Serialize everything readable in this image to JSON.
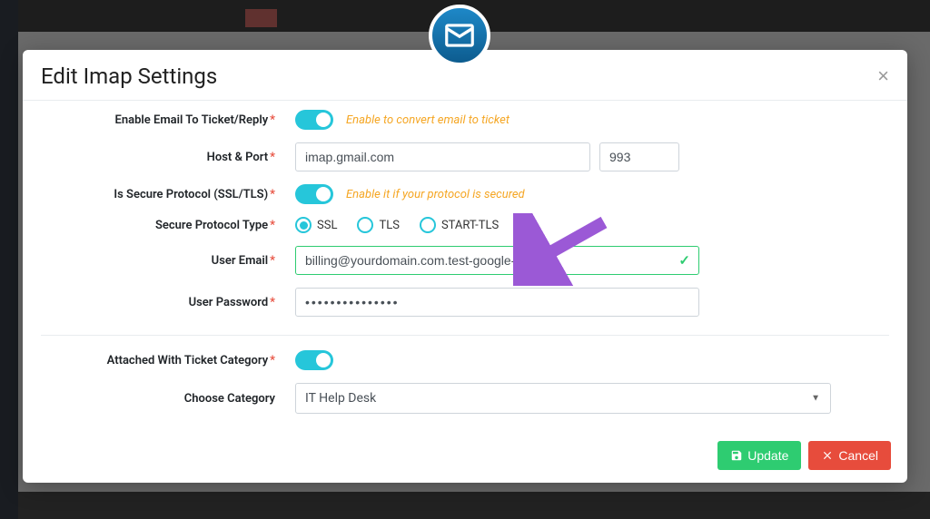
{
  "modal": {
    "title": "Edit Imap Settings",
    "fields": {
      "enable_email": {
        "label": "Enable Email To Ticket/Reply",
        "hint": "Enable to convert email to ticket",
        "value": true
      },
      "host": {
        "label": "Host & Port",
        "host_value": "imap.gmail.com",
        "port_value": "993"
      },
      "secure_protocol": {
        "label": "Is Secure Protocol (SSL/TLS)",
        "hint": "Enable it if your protocol is secured",
        "value": true
      },
      "protocol_type": {
        "label": "Secure Protocol Type",
        "options": [
          "SSL",
          "TLS",
          "START-TLS"
        ],
        "selected": "SSL"
      },
      "user_email": {
        "label": "User Email",
        "value": "billing@yourdomain.com.test-google-a.com",
        "valid": true
      },
      "user_password": {
        "label": "User Password",
        "masked": "•••••••••••••••"
      },
      "attached_category": {
        "label": "Attached With Ticket Category",
        "value": true
      },
      "category": {
        "label": "Choose Category",
        "selected": "IT Help Desk"
      }
    },
    "buttons": {
      "update": "Update",
      "cancel": "Cancel"
    }
  }
}
